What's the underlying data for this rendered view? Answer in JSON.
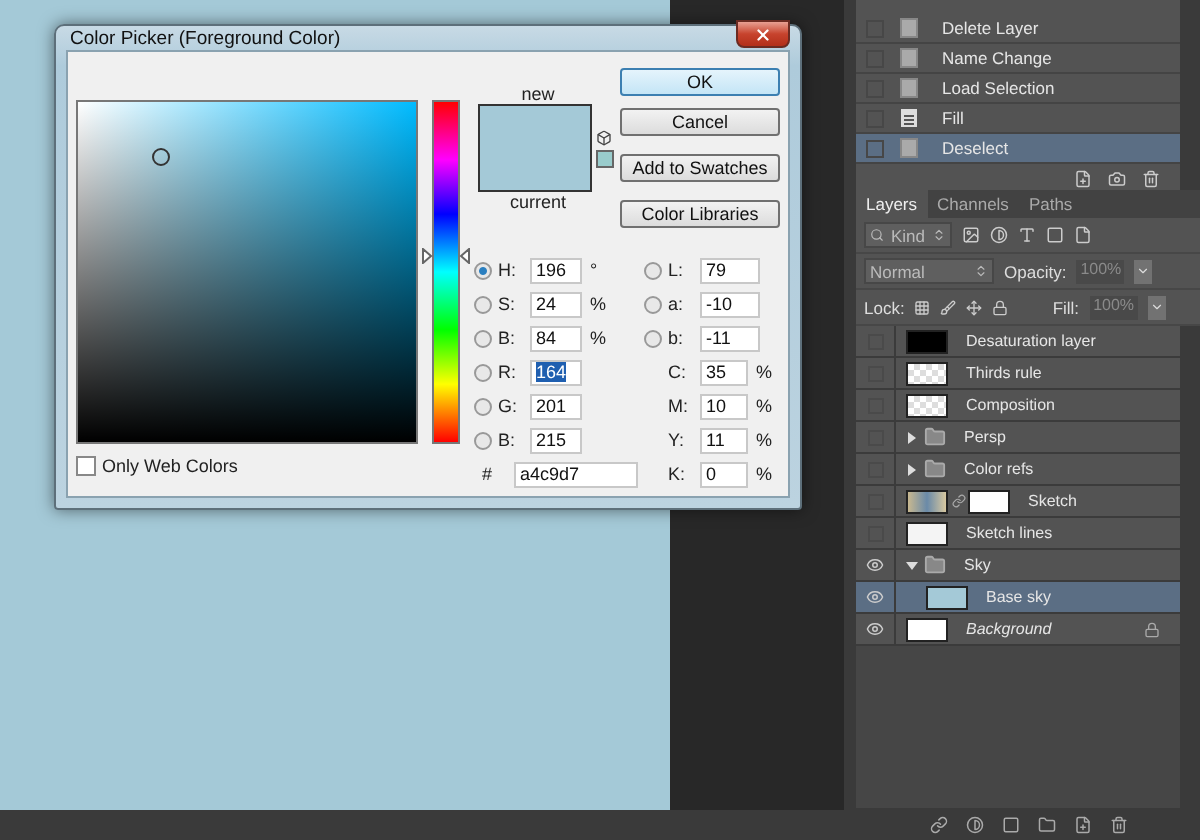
{
  "window": {
    "title": "Color Picker (Foreground Color)"
  },
  "color_field": {
    "only_web_colors": {
      "label": "Only Web Colors",
      "checked": false
    }
  },
  "hue_slider": {
    "level": 0.544
  },
  "preview": {
    "new_label": "new",
    "current_label": "current"
  },
  "buttons": [
    {
      "label": "OK",
      "default": true
    },
    {
      "label": "Cancel",
      "default": false
    },
    {
      "label": "Add to Swatches",
      "default": false
    },
    {
      "label": "Color Libraries",
      "default": false
    }
  ],
  "hsb": [
    {
      "label": "H:",
      "value": "196",
      "unit": "°",
      "selected": true
    },
    {
      "label": "S:",
      "value": "24",
      "unit": "%",
      "selected": false
    },
    {
      "label": "B:",
      "value": "84",
      "unit": "%",
      "selected": false
    }
  ],
  "rgb": [
    {
      "label": "R:",
      "value": "164",
      "selected": false,
      "highlighted": true
    },
    {
      "label": "G:",
      "value": "201",
      "selected": false,
      "highlighted": false
    },
    {
      "label": "B:",
      "value": "215",
      "selected": false,
      "highlighted": false
    }
  ],
  "hex": {
    "label": "#",
    "value": "a4c9d7"
  },
  "lab": [
    {
      "label": "L:",
      "value": "79",
      "selected": false
    },
    {
      "label": "a:",
      "value": "-10",
      "selected": false
    },
    {
      "label": "b:",
      "value": "-11",
      "selected": false
    }
  ],
  "cmyk": [
    {
      "label": "C:",
      "value": "35",
      "unit": "%"
    },
    {
      "label": "M:",
      "value": "10",
      "unit": "%"
    },
    {
      "label": "Y:",
      "value": "11",
      "unit": "%"
    },
    {
      "label": "K:",
      "value": "0",
      "unit": "%"
    }
  ],
  "history": {
    "items": [
      {
        "label": "Delete Layer",
        "kind": "snapshot",
        "selected": false
      },
      {
        "label": "Name Change",
        "kind": "snapshot",
        "selected": false
      },
      {
        "label": "Load Selection",
        "kind": "snapshot",
        "selected": false
      },
      {
        "label": "Fill",
        "kind": "fill",
        "selected": false
      },
      {
        "label": "Deselect",
        "kind": "snapshot",
        "selected": true
      }
    ]
  },
  "layers_panel": {
    "tabs": [
      {
        "label": "Layers",
        "selected": true
      },
      {
        "label": "Channels",
        "selected": false
      },
      {
        "label": "Paths",
        "selected": false
      }
    ],
    "filter": {
      "value": "Kind"
    },
    "blend_mode": {
      "value": "Normal"
    },
    "opacity": {
      "label": "Opacity:",
      "value": "100%",
      "disabled": true
    },
    "lock": {
      "label": "Lock:"
    },
    "fill": {
      "label": "Fill:",
      "value": "100%",
      "disabled": true
    },
    "layers": [
      {
        "name": "Desaturation layer",
        "kind": "layer",
        "thumb": {
          "kind": "black"
        },
        "visible": false,
        "selected": false
      },
      {
        "name": "Thirds rule",
        "kind": "layer",
        "thumb": {
          "kind": "transparent"
        },
        "visible": false,
        "selected": false
      },
      {
        "name": "Composition",
        "kind": "layer",
        "thumb": {
          "kind": "transparent"
        },
        "visible": false,
        "selected": false
      },
      {
        "name": "Persp",
        "kind": "group",
        "expanded": false,
        "visible": false,
        "selected": false
      },
      {
        "name": "Color refs",
        "kind": "group",
        "expanded": false,
        "visible": false,
        "selected": false
      },
      {
        "name": "Sketch",
        "kind": "layer",
        "thumb": {
          "kind": "photo"
        },
        "mask": true,
        "visible": false,
        "selected": false
      },
      {
        "name": "Sketch lines",
        "kind": "layer",
        "thumb": {
          "kind": "sketch"
        },
        "visible": false,
        "selected": false
      },
      {
        "name": "Sky",
        "kind": "group",
        "expanded": true,
        "visible": true,
        "selected": false,
        "children": [
          {
            "name": "Base sky",
            "kind": "layer",
            "thumb": {
              "kind": "sky"
            },
            "visible": true,
            "selected": true
          }
        ]
      },
      {
        "name": "Background",
        "kind": "background",
        "thumb": {
          "kind": "white"
        },
        "locked": true,
        "visible": true,
        "selected": false
      }
    ]
  }
}
